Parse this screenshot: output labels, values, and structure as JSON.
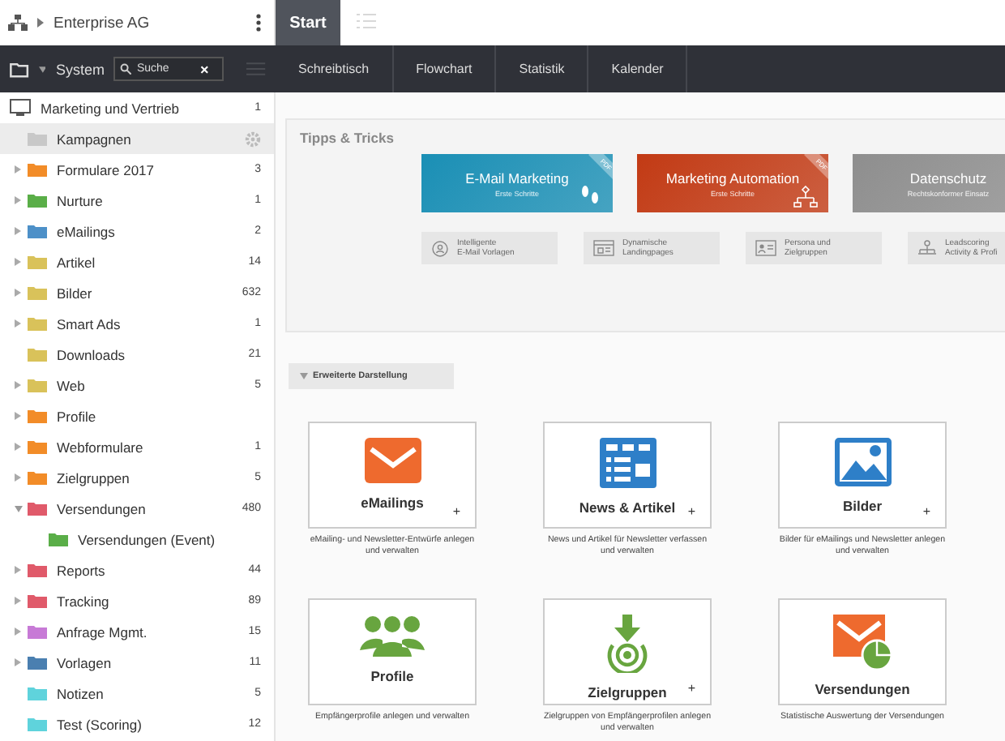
{
  "header": {
    "company": "Enterprise AG",
    "tabs": [
      {
        "label": "Start",
        "selected": true
      }
    ]
  },
  "toolbar": {
    "system": "System",
    "search": {
      "value": "Suche"
    },
    "clear": "×",
    "tabs": [
      {
        "label": "Schreibtisch",
        "selected": false
      },
      {
        "label": "Flowchart",
        "selected": false
      },
      {
        "label": "Statistik",
        "selected": false
      },
      {
        "label": "Kalender",
        "selected": false
      }
    ]
  },
  "sidebar": {
    "tree": [
      {
        "label": "Marketing und Vertrieb",
        "count": "1",
        "kind": "root",
        "selected": false,
        "children": [
          {
            "label": "Kampagnen",
            "kind": "leaf",
            "selected": true,
            "color": "#c8c8c8"
          },
          {
            "label": "Formulare 2017",
            "count": "3",
            "kind": "branch",
            "expanded": false,
            "selected": false,
            "color": "#f28c28"
          },
          {
            "label": "Nurture",
            "count": "1",
            "kind": "branch",
            "expanded": false,
            "selected": false,
            "color": "#5aae48"
          },
          {
            "label": "eMailings",
            "count": "2",
            "kind": "branch",
            "expanded": false,
            "selected": false,
            "color": "#4d90c8"
          },
          {
            "label": "Artikel",
            "count": "14",
            "kind": "branch",
            "expanded": false,
            "selected": false,
            "color": "#d9c25a"
          },
          {
            "label": "Bilder",
            "count": "632",
            "kind": "branch",
            "expanded": false,
            "selected": false,
            "color": "#d9c25a"
          },
          {
            "label": "Smart Ads",
            "count": "1",
            "kind": "branch",
            "expanded": false,
            "selected": false,
            "color": "#d9c25a"
          },
          {
            "label": "Downloads",
            "count": "21",
            "kind": "leaf",
            "selected": false,
            "color": "#d9c25a"
          },
          {
            "label": "Web",
            "count": "5",
            "kind": "branch",
            "expanded": false,
            "selected": false,
            "color": "#d9c25a"
          },
          {
            "label": "Profile",
            "kind": "branch",
            "expanded": false,
            "selected": false,
            "color": "#f28c28"
          },
          {
            "label": "Webformulare",
            "count": "1",
            "kind": "branch",
            "expanded": false,
            "selected": false,
            "color": "#f28c28"
          },
          {
            "label": "Zielgruppen",
            "count": "5",
            "kind": "branch",
            "expanded": false,
            "selected": false,
            "color": "#f28c28"
          },
          {
            "label": "Versendungen",
            "count": "480",
            "kind": "branch",
            "expanded": true,
            "selected": false,
            "color": "#e05a6a",
            "children": [
              {
                "label": "Versendungen (Event)",
                "kind": "leaf",
                "selected": false,
                "color": "#5aae48"
              }
            ]
          },
          {
            "label": "Reports",
            "count": "44",
            "kind": "branch",
            "expanded": false,
            "selected": false,
            "color": "#e05a6a"
          },
          {
            "label": "Tracking",
            "count": "89",
            "kind": "branch",
            "expanded": false,
            "selected": false,
            "color": "#e05a6a"
          },
          {
            "label": "Anfrage Mgmt.",
            "count": "15",
            "kind": "branch",
            "expanded": false,
            "selected": false,
            "color": "#c77ad6"
          },
          {
            "label": "Vorlagen",
            "count": "11",
            "kind": "branch",
            "expanded": false,
            "selected": false,
            "color": "#4a7fb0"
          },
          {
            "label": "Notizen",
            "count": "5",
            "kind": "leaf",
            "selected": false,
            "color": "#5fd3dc"
          },
          {
            "label": "Test (Scoring)",
            "count": "12",
            "kind": "leaf",
            "selected": false,
            "color": "#5fd3dc"
          }
        ]
      }
    ]
  },
  "tips": {
    "title": "Tipps & Tricks",
    "banners": [
      {
        "title": "E-Mail Marketing",
        "subtitle": "Erste Schritte",
        "badge": "PDF",
        "kind": "steps",
        "color": "#1a8fb5"
      },
      {
        "title": "Marketing Automation",
        "subtitle": "Erste Schritte",
        "badge": "PDF",
        "kind": "flow",
        "color": "#c23a14"
      },
      {
        "title": "Datenschutz",
        "subtitle": "Rechtskonformer Einsatz",
        "kind": "none",
        "color": "#8e8e8e"
      }
    ],
    "tiles": [
      {
        "lines": [
          "Intelligente",
          "E-Mail Vorlagen"
        ],
        "kind": "person"
      },
      {
        "lines": [
          "Dynamische",
          "Landingpages"
        ],
        "kind": "page"
      },
      {
        "lines": [
          "Persona und",
          "Zielgruppen"
        ],
        "kind": "card"
      },
      {
        "lines": [
          "Leadscoring",
          "Activity & Profi"
        ],
        "kind": "org"
      }
    ]
  },
  "advanced_button": {
    "label": "Erweiterte Darstellung",
    "expanded": true
  },
  "cards": [
    {
      "title": "eMailings",
      "plus": "+",
      "description": "eMailing- und Newsletter-Entwürfe anlegen und verwalten",
      "kind": "mail"
    },
    {
      "title": "News & Artikel",
      "plus": "+",
      "description": "News und Artikel für Newsletter verfassen und verwalten",
      "kind": "news"
    },
    {
      "title": "Bilder",
      "plus": "+",
      "description": "Bilder für eMailings und Newsletter anlegen und verwalten",
      "kind": "image"
    },
    {
      "title": "Profile",
      "description": "Empfängerprofile anlegen und verwalten",
      "kind": "people"
    },
    {
      "title": "Zielgruppen",
      "plus": "+",
      "description": "Zielgruppen von Empfängerprofilen anlegen und verwalten",
      "kind": "target"
    },
    {
      "title": "Versendungen",
      "description": "Statistische Auswertung der Versendungen",
      "kind": "stats"
    }
  ]
}
